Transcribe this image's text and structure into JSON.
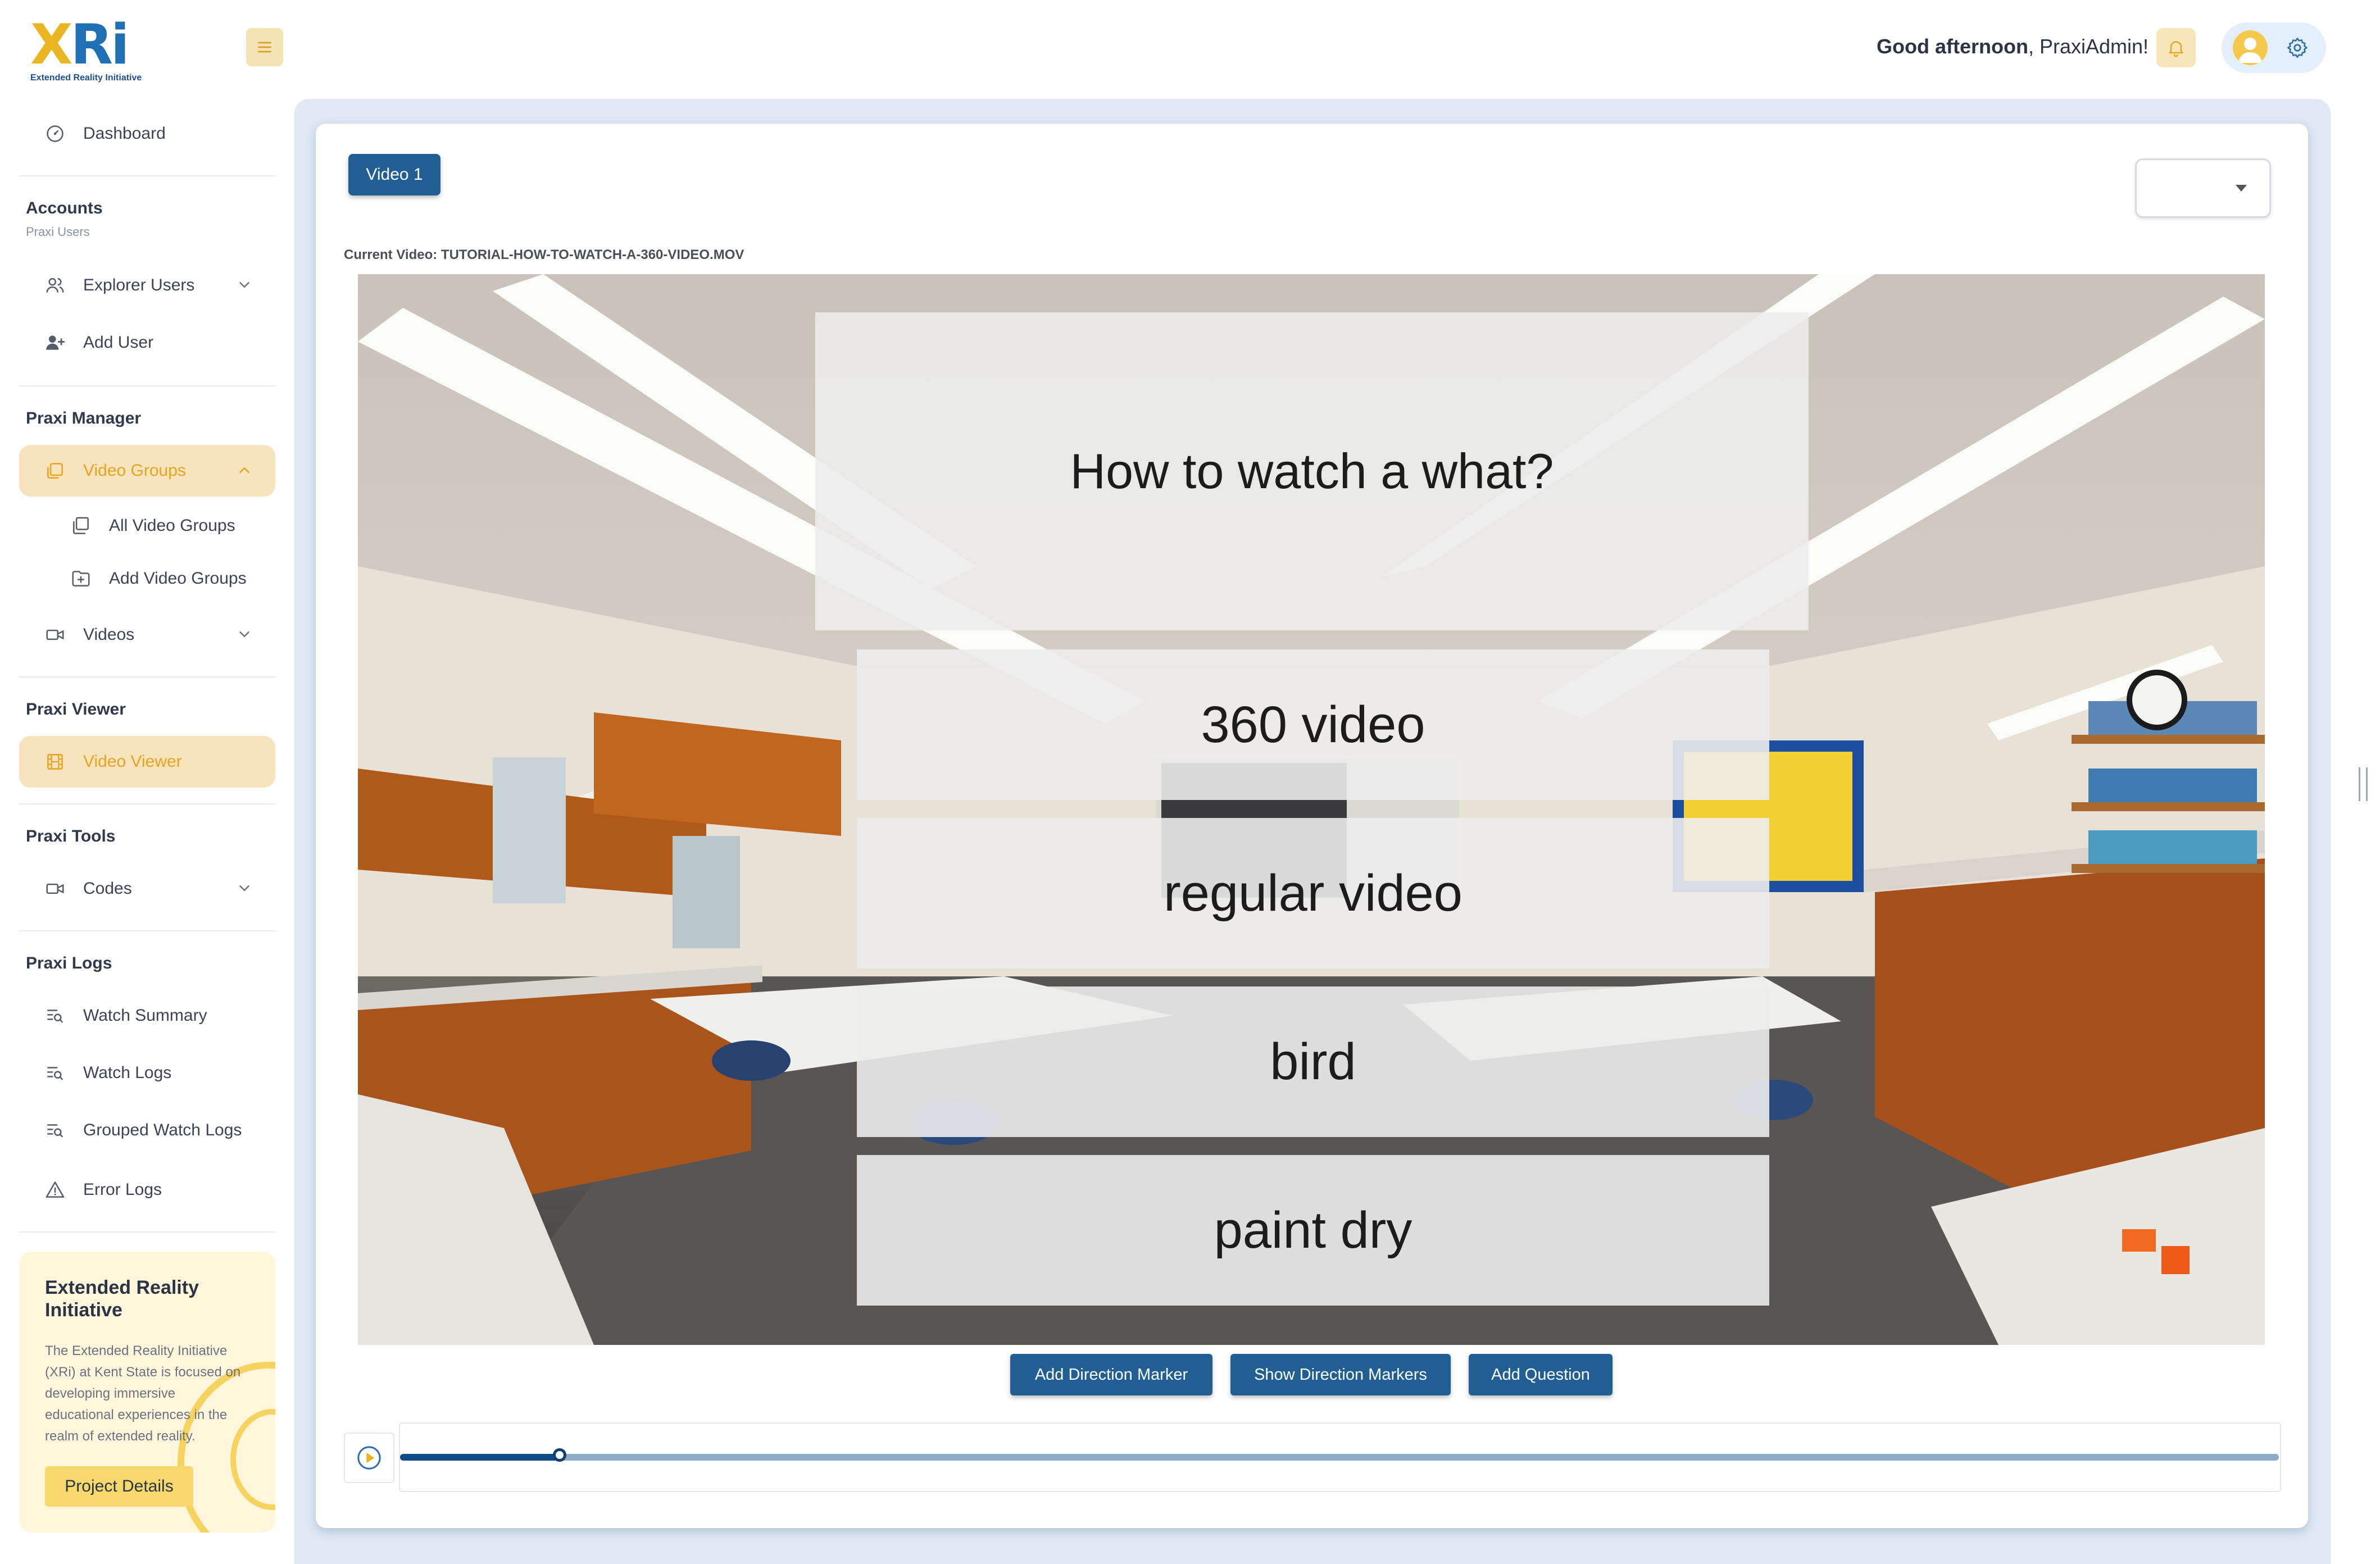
{
  "logo": {
    "mark_x": "X",
    "mark_ri": "Ri",
    "subtitle": "Extended Reality Initiative"
  },
  "header": {
    "greeting_bold": "Good afternoon",
    "greeting_rest": ", PraxiAdmin!"
  },
  "sidebar": {
    "dashboard": "Dashboard",
    "accounts_title": "Accounts",
    "accounts_sub": "Praxi Users",
    "explorer_users": "Explorer Users",
    "add_user": "Add User",
    "manager_title": "Praxi Manager",
    "video_groups": "Video Groups",
    "all_video_groups": "All Video Groups",
    "add_video_groups": "Add Video Groups",
    "videos": "Videos",
    "viewer_title": "Praxi Viewer",
    "video_viewer": "Video Viewer",
    "tools_title": "Praxi Tools",
    "codes": "Codes",
    "logs_title": "Praxi Logs",
    "watch_summary": "Watch Summary",
    "watch_logs": "Watch Logs",
    "grouped_watch_logs": "Grouped Watch Logs",
    "error_logs": "Error Logs"
  },
  "promo": {
    "title": "Extended Reality Initiative",
    "description": "The Extended Reality Initiative (XRi) at Kent State is focused on developing immersive educational experiences in the realm of extended reality.",
    "button": "Project Details"
  },
  "main": {
    "video_tab": "Video 1",
    "current_video_label": "Current Video: TUTORIAL-HOW-TO-WATCH-A-360-VIDEO.MOV",
    "question": "How to watch a what?",
    "answers": [
      "360 video",
      "regular video",
      "bird",
      "paint dry"
    ],
    "buttons": {
      "add_direction_marker": "Add Direction Marker",
      "show_direction_markers": "Show Direction Markers",
      "add_question": "Add Question"
    },
    "progress_fraction": 0.085
  },
  "colors": {
    "accent_blue": "#215f93",
    "accent_yellow": "#e6a51c",
    "active_bg": "#f7e4bf"
  }
}
